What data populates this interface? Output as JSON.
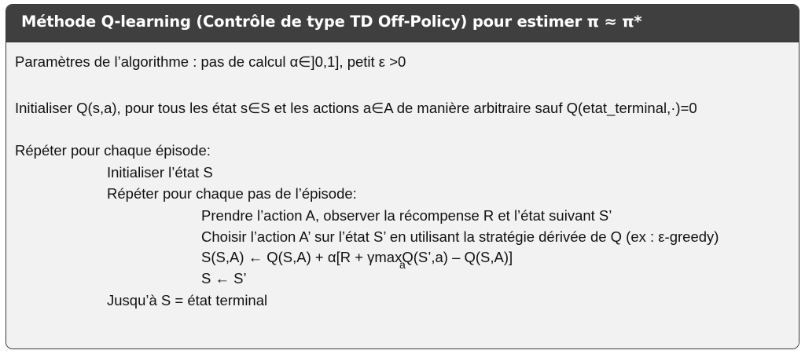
{
  "title": "Méthode Q-learning (Contrôle de type TD Off-Policy) pour estimer π ≈ π*",
  "lines": {
    "params": "Paramètres de l’algorithme : pas de calcul α∈]0,1], petit ε >0",
    "init_q": "Initialiser Q(s,a), pour tous les état s∈S et les actions a∈A de manière arbitraire sauf Q(etat_terminal,·)=0",
    "repeat_episode": "Répéter pour chaque épisode:",
    "init_state": "Initialiser l’état S",
    "repeat_step": "Répéter pour chaque pas de l’épisode:",
    "take_action": "Prendre l’action A, observer la récompense R et l’état suivant S’",
    "choose_action": "Choisir l’action A’  sur l’état S’ en utilisant la stratégie dérivée de Q (ex : ε-greedy)",
    "update": "S(S,A) ← Q(S,A) + α[R + γmaxQ(S’,a) – Q(S,A)]",
    "update_subscript": "a",
    "assign_state": "S ← S’",
    "until": "Jusqu’à S = état terminal"
  }
}
